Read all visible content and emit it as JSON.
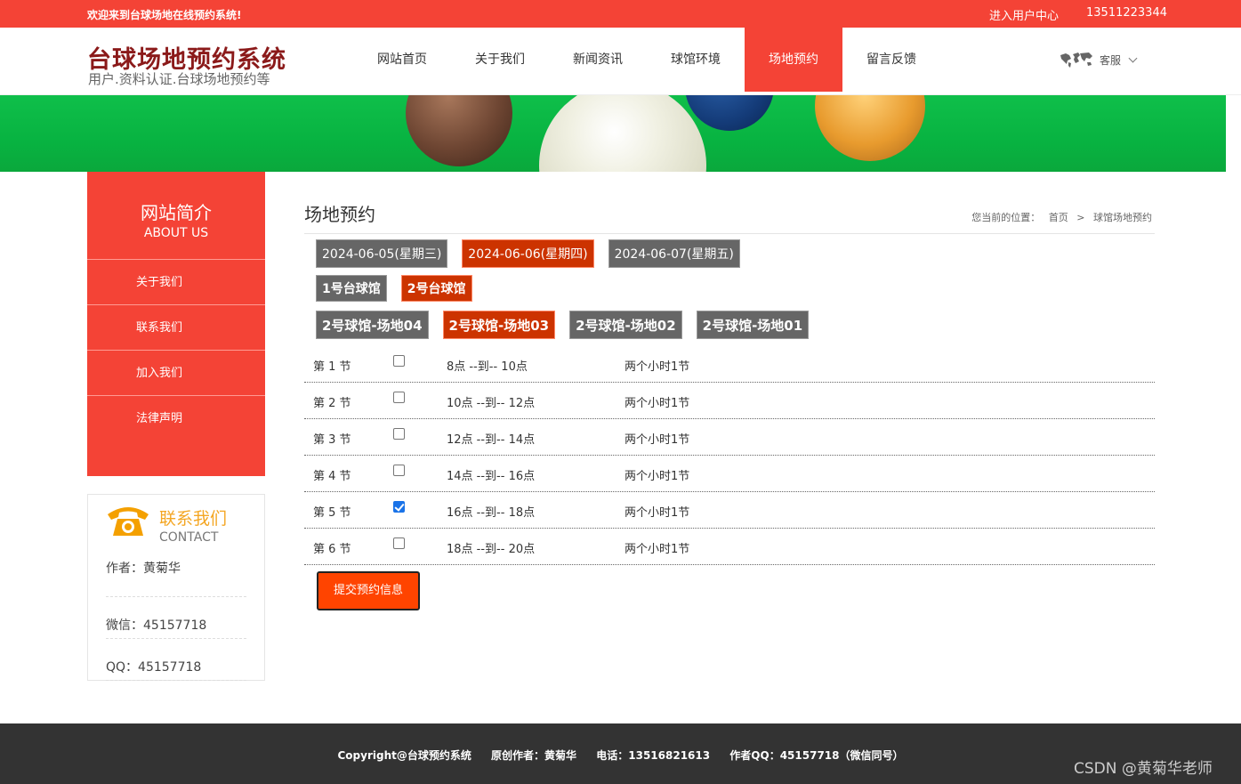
{
  "topbar": {
    "welcome": "欢迎来到台球场地在线预约系统!",
    "user_center": "进入用户中心",
    "phone": "13511223344"
  },
  "logo": {
    "title": "台球场地预约系统",
    "subtitle": "用户.资料认证.台球场地预约等"
  },
  "nav": {
    "items": [
      {
        "label": "网站首页"
      },
      {
        "label": "关于我们"
      },
      {
        "label": "新闻资讯"
      },
      {
        "label": "球馆环境"
      },
      {
        "label": "场地预约",
        "active": true
      },
      {
        "label": "留言反馈"
      }
    ],
    "service_label": "客服"
  },
  "sidebar": {
    "title": "网站简介",
    "subtitle": "ABOUT US",
    "items": [
      {
        "label": "关于我们"
      },
      {
        "label": "联系我们"
      },
      {
        "label": "加入我们"
      },
      {
        "label": "法律声明"
      }
    ]
  },
  "contact": {
    "title": "联系我们",
    "subtitle": "CONTACT",
    "lines": [
      "作者：黄菊华",
      "微信：45157718",
      "QQ：45157718"
    ]
  },
  "main": {
    "title": "场地预约",
    "breadcrumb_prefix": "您当前的位置：",
    "breadcrumb_home": "首页",
    "breadcrumb_sep": ">",
    "breadcrumb_current": "球馆场地预约",
    "dates": [
      {
        "label": "2024-06-05(星期三)"
      },
      {
        "label": "2024-06-06(星期四)",
        "active": true
      },
      {
        "label": "2024-06-07(星期五)"
      }
    ],
    "halls": [
      {
        "label": "1号台球馆"
      },
      {
        "label": "2号台球馆",
        "active": true
      }
    ],
    "venues": [
      {
        "label": "2号球馆-场地04"
      },
      {
        "label": "2号球馆-场地03",
        "active": true
      },
      {
        "label": "2号球馆-场地02"
      },
      {
        "label": "2号球馆-场地01"
      }
    ],
    "slots": [
      {
        "session": "第 1 节",
        "time": "8点 --到-- 10点",
        "note": "两个小时1节",
        "checked": false
      },
      {
        "session": "第 2 节",
        "time": "10点 --到-- 12点",
        "note": "两个小时1节",
        "checked": false
      },
      {
        "session": "第 3 节",
        "time": "12点 --到-- 14点",
        "note": "两个小时1节",
        "checked": false
      },
      {
        "session": "第 4 节",
        "time": "14点 --到-- 16点",
        "note": "两个小时1节",
        "checked": false
      },
      {
        "session": "第 5 节",
        "time": "16点 --到-- 18点",
        "note": "两个小时1节",
        "checked": true
      },
      {
        "session": "第 6 节",
        "time": "18点 --到-- 20点",
        "note": "两个小时1节",
        "checked": false
      }
    ],
    "submit_label": "提交预约信息"
  },
  "footer": {
    "copyright": "Copyright@台球预约系统",
    "author": "原创作者：黄菊华",
    "phone": "电话：13516821613",
    "qq": "作者QQ：45157718（微信同号）",
    "watermark": "CSDN @黄菊华老师"
  },
  "colors": {
    "brand_red": "#f44336",
    "active_chip": "#cc3300",
    "chip_gray": "#666666",
    "submit_orange": "#ff4400",
    "contact_gold": "#f4a623"
  }
}
